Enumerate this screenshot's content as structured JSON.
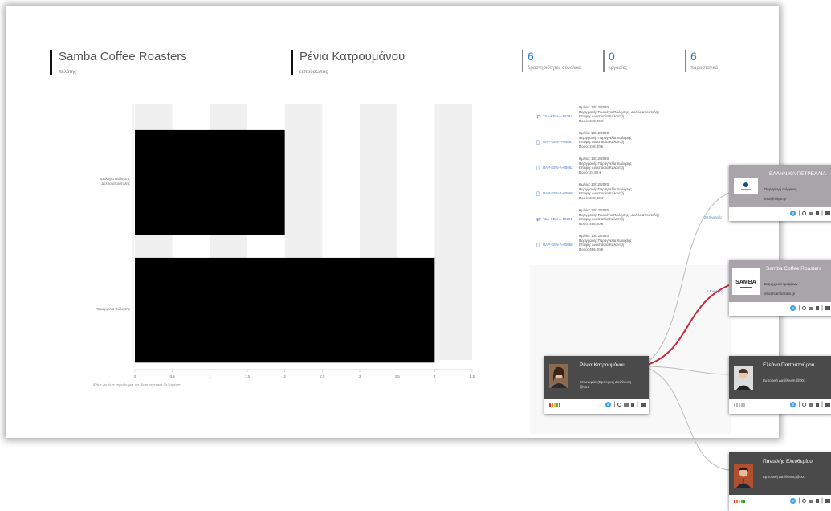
{
  "header": {
    "customer_name": "Samba Coffee Roasters",
    "customer_sub": "πελάτης",
    "rep_name": "Ρένια Κατρουμάνου",
    "rep_sub": "εκπρόσωπος"
  },
  "kpis": [
    {
      "value": "6",
      "label": "δραστηριότητες συνολικά"
    },
    {
      "value": "0",
      "label": "εργασίες"
    },
    {
      "value": "6",
      "label": "παραστατικά"
    }
  ],
  "chart_data": {
    "type": "bar",
    "orientation": "horizontal",
    "categories": [
      "Τιμολόγιο Πώλησης - Δελτίο αποστολής",
      "Παραγγελία πώλησης"
    ],
    "values": [
      2,
      4
    ],
    "xlim": [
      0,
      4.5
    ],
    "x_ticks": [
      "0",
      "0.5",
      "1",
      "1.5",
      "2",
      "2.5",
      "3",
      "3.5",
      "4",
      "4.5"
    ],
    "bar_color": "#000000",
    "title": "",
    "xlabel": "",
    "ylabel": ""
  },
  "chart_hint": "Κάνε σε ένα σημείο για να δείτε σχετικά δεδομένα",
  "activities": [
    {
      "icon": "⇄",
      "code": "ΤΔΑ-ΚΕΝ-Α-18293",
      "date": "Ημ/νία: 13/12/2020",
      "desc": "Περιγραφή: Τιμολόγιο Πώλησης - Δελτίο αποστολής",
      "contact": "Επαφή: Αναστασία Καλαντζή",
      "amount": "Ποσό: 248,00 €"
    },
    {
      "icon": "▯",
      "code": "ΠΑΡ-ΚΕΝ-Α-00061",
      "date": "Ημ/νία: 13/12/2020",
      "desc": "Περιγραφή: Παραγγελία πώλησης",
      "contact": "Επαφή: Αναστασία Καλαντζή",
      "amount": "Ποσό: 248,00 €"
    },
    {
      "icon": "▯",
      "code": "ΠΑΡ-ΚΕΝ-Α-00062",
      "date": "Ημ/νία: 13/12/2020",
      "desc": "Περιγραφή: Παραγγελία πώλησης",
      "contact": "Επαφή: Αναστασία Καλαντζή",
      "amount": "Ποσό: 24,80 €"
    },
    {
      "icon": "▯",
      "code": "ΠΑΡ-ΚΕΝ-Α-00060",
      "date": "Ημ/νία: 13/12/2020",
      "desc": "Περιγραφή: Παραγγελία πώλησης",
      "contact": "Επαφή: Αναστασία Καλαντζή",
      "amount": "Ποσό: 248,00 €"
    },
    {
      "icon": "⇄",
      "code": "ΤΔΑ-ΚΕΝ-Α-18291",
      "date": "Ημ/νία: 13/12/2020",
      "desc": "Περιγραφή: Τιμολόγιο Πώλησης - Δελτίο αποστολής",
      "contact": "Επαφή: Αναστασία Καλαντζή",
      "amount": "Ποσό: 496,00 €"
    },
    {
      "icon": "▯",
      "code": "ΠΑΡ-ΚΕΝ-Α-00058",
      "date": "Ημ/νία: 10/12/2020",
      "desc": "Περιγραφή: Παραγγελία πώλησης",
      "contact": "Επαφή: Αναστασία Καλαντζή",
      "amount": "Ποσό: 496,00 €"
    }
  ],
  "edge_labels": [
    "20 Ενεργές",
    "6 Ενεργές"
  ],
  "nodes": {
    "center": {
      "name": "Ρένια Κατρουμάνου",
      "role": "Επωνυμία: (Εμπορική Διεύθυνση @001",
      "head_color": "#4a4a4a"
    },
    "elpe": {
      "name": "ΕΛΛΗΝΙΚΑ ΠΕΤΡΕΛΑΙΑ",
      "role": "Παραγωγή ενέργειας",
      "email": "info@helpe.gr",
      "head_color": "#a9a4aa"
    },
    "samba": {
      "name": "Samba Coffee Roasters",
      "role": "Βιομηχανία τροφίμων",
      "email": "info@sambacafe.gr",
      "logo": "SAMBA",
      "head_color": "#a9a4aa"
    },
    "eleana": {
      "name": "Ελεάνα Παπασταύρου",
      "role": "Εμπορική Διεύθυνση @001",
      "head_color": "#4a4a4a"
    },
    "pantelis": {
      "name": "Παντελής Ελευθερίου",
      "role": "Εμπορική Διεύθυνση @001",
      "head_color": "#4a4a4a"
    }
  },
  "colors": {
    "accent": "#2b7bd8",
    "active_edge": "#c8283a",
    "edge": "#bbbbbb"
  }
}
